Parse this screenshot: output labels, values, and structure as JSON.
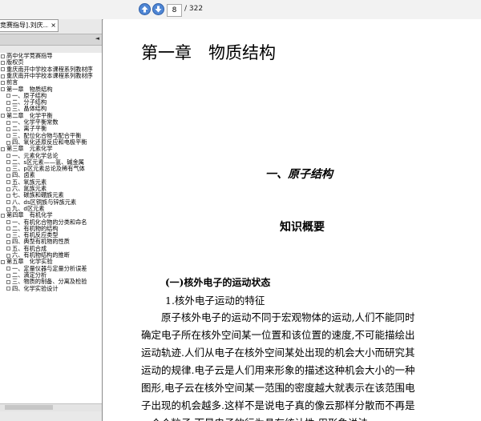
{
  "toolbar": {
    "prev_icon": "arrow-up-icon",
    "next_icon": "arrow-down-icon",
    "page_current": "8",
    "page_total": "/ 322"
  },
  "sidebar": {
    "tab_label": "竞赛指导].刘庆...",
    "tab_close": "×",
    "collapse": "◄",
    "tree": [
      {
        "label": "高中化学竞赛指导",
        "indent": 0
      },
      {
        "label": "版权页",
        "indent": 0
      },
      {
        "label": "重庆南开中学校本课程系列教材序",
        "indent": 0
      },
      {
        "label": "重庆南开中学校本课程系列教材序",
        "indent": 0
      },
      {
        "label": "前言",
        "indent": 0
      },
      {
        "label": "第一章　物质结构",
        "indent": 0
      },
      {
        "label": "一、原子结构",
        "indent": 1
      },
      {
        "label": "二、分子结构",
        "indent": 1
      },
      {
        "label": "三、晶体结构",
        "indent": 1
      },
      {
        "label": "第二章　化学平衡",
        "indent": 0
      },
      {
        "label": "一、化学平衡常数",
        "indent": 1
      },
      {
        "label": "二、离子平衡",
        "indent": 1
      },
      {
        "label": "三、配位化合物与配合平衡",
        "indent": 1
      },
      {
        "label": "四、氧化还原反应和电极平衡",
        "indent": 1
      },
      {
        "label": "第三章　元素化学",
        "indent": 0
      },
      {
        "label": "一、元素化学总论",
        "indent": 1
      },
      {
        "label": "二、s区元素——氢、碱金属",
        "indent": 1
      },
      {
        "label": "三、p区元素总论及稀有气体",
        "indent": 1
      },
      {
        "label": "四、卤素",
        "indent": 1
      },
      {
        "label": "五、氧族元素",
        "indent": 1
      },
      {
        "label": "六、氮族元素",
        "indent": 1
      },
      {
        "label": "七、碳族和硼族元素",
        "indent": 1
      },
      {
        "label": "八、ds区铜族与锌族元素",
        "indent": 1
      },
      {
        "label": "九、d区元素",
        "indent": 1
      },
      {
        "label": "第四章　有机化学",
        "indent": 0
      },
      {
        "label": "一、有机化合物的分类和命名",
        "indent": 1
      },
      {
        "label": "二、有机物的结构",
        "indent": 1
      },
      {
        "label": "三、有机反应类型",
        "indent": 1
      },
      {
        "label": "四、典型有机物的性质",
        "indent": 1
      },
      {
        "label": "五、有机合成",
        "indent": 1
      },
      {
        "label": "六、有机物结构的推断",
        "indent": 1
      },
      {
        "label": "第五章　化学实验",
        "indent": 0
      },
      {
        "label": "一、定量仪器与定量分析误差",
        "indent": 1
      },
      {
        "label": "二、滴定分析",
        "indent": 1
      },
      {
        "label": "三、物质的制备、分离及检验",
        "indent": 1
      },
      {
        "label": "四、化学实验设计",
        "indent": 1
      }
    ]
  },
  "document": {
    "chapter_title": "第一章　物质结构",
    "section_title": "一、原子结构",
    "overview": "知识概要",
    "sub_a": "(一)核外电子的运动状态",
    "sub_b": "1.核外电子运动的特征",
    "paragraph_lines": [
      "　　原子核外电子的运动不同于宏观物体的运动,人们不能同时",
      "确定电子所在核外空间某一位置和该位置的速度,不可能描绘出",
      "运动轨迹.人们从电子在核外空间某处出现的机会大小而研究其",
      "运动的规律.电子云是人们用来形象的描述这种机会大小的一种",
      "图形,电子云在核外空间某一范围的密度越大就表示在该范围电",
      "子出现的机会越多.这样不是说电子真的像云那样分散而不再是",
      "一个个粒子,而是电子的行为具有统计性,用形象说法"
    ]
  }
}
